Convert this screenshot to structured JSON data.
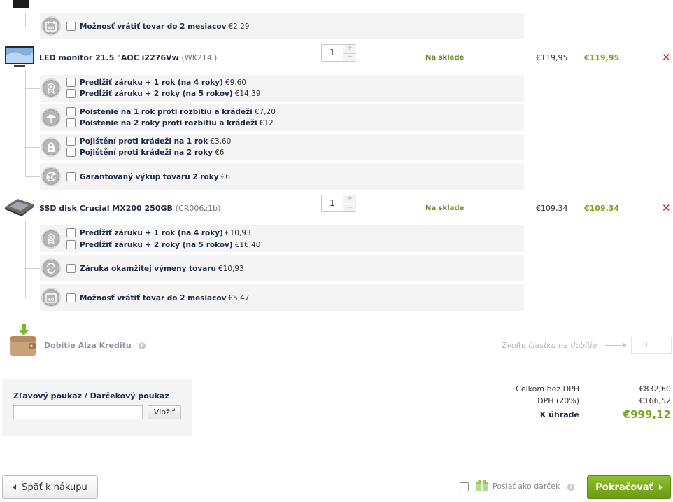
{
  "services_top": [
    {
      "label": "Možnosť vrátiť tovar do 2 mesiacov",
      "price": "€2,29",
      "icon": "return-60-icon"
    }
  ],
  "products": [
    {
      "name": "LED monitor 21.5 \"AOC i2276Vw",
      "code": "(WK214i)",
      "qty": "1",
      "stock": "Na sklade",
      "unit_price": "€119,95",
      "total_price": "€119,95",
      "remove": "✕",
      "groups": [
        {
          "icon": "warranty-icon",
          "items": [
            {
              "label": "Predĺžiť záruku + 1 rok (na 4 roky)",
              "price": "€9,60"
            },
            {
              "label": "Predĺžiť záruku + 2 roky (na 5 rokov)",
              "price": "€14,39"
            }
          ]
        },
        {
          "icon": "umbrella-insurance-icon",
          "items": [
            {
              "label": "Poistenie na 1 rok proti rozbitiu a krádeži",
              "price": "€7,20"
            },
            {
              "label": "Poistenie na 2 roky proti rozbitiu a krádeži",
              "price": "€12"
            }
          ]
        },
        {
          "icon": "lock-icon",
          "items": [
            {
              "label": "Pojištění proti krádeži na 1 rok",
              "price": "€3,60"
            },
            {
              "label": "Pojištění proti krádeži na 2 roky",
              "price": "€6"
            }
          ]
        },
        {
          "icon": "buyback-icon",
          "items": [
            {
              "label": "Garantovaný výkup tovaru 2 roky",
              "price": "€6"
            }
          ]
        }
      ]
    },
    {
      "name": "SSD disk Crucial MX200 250GB",
      "code": "(CR006z1b)",
      "qty": "1",
      "stock": "Na sklade",
      "unit_price": "€109,34",
      "total_price": "€109,34",
      "remove": "✕",
      "groups": [
        {
          "icon": "warranty-icon",
          "items": [
            {
              "label": "Predĺžiť záruku + 1 rok (na 4 roky)",
              "price": "€10,93"
            },
            {
              "label": "Predĺžiť záruku + 2 roky (na 5 rokov)",
              "price": "€16,40"
            }
          ]
        },
        {
          "icon": "exchange-icon",
          "items": [
            {
              "label": "Záruka okamžitej výmeny tovaru",
              "price": "€10,93"
            }
          ]
        },
        {
          "icon": "return-60-icon",
          "items": [
            {
              "label": "Možnosť vrátiť tovar do 2 mesiacov",
              "price": "€5,47"
            }
          ]
        }
      ]
    }
  ],
  "credit": {
    "label": "Dobitie Alza Kreditu",
    "info": "i",
    "hint": "Zvoľte čiastku na dobitie",
    "value": "0"
  },
  "voucher": {
    "title": "Zľavový poukaz / Darčekový poukaz",
    "input_value": "",
    "button": "Vložiť"
  },
  "totals": {
    "without_vat_label": "Celkom bez DPH",
    "without_vat": "€832,60",
    "vat_label": "DPH (20%)",
    "vat": "€166,52",
    "to_pay_label": "K úhrade",
    "to_pay": "€999,12"
  },
  "footer": {
    "back": "Späť k nákupu",
    "gift_label": "Poslať ako darček",
    "gift_info": "i",
    "continue": "Pokračovať"
  },
  "colors": {
    "accent_green": "#7aa31c",
    "stock_green": "#5a8a14",
    "remove_red": "#c8202a",
    "label_navy": "#1e2a4a"
  }
}
